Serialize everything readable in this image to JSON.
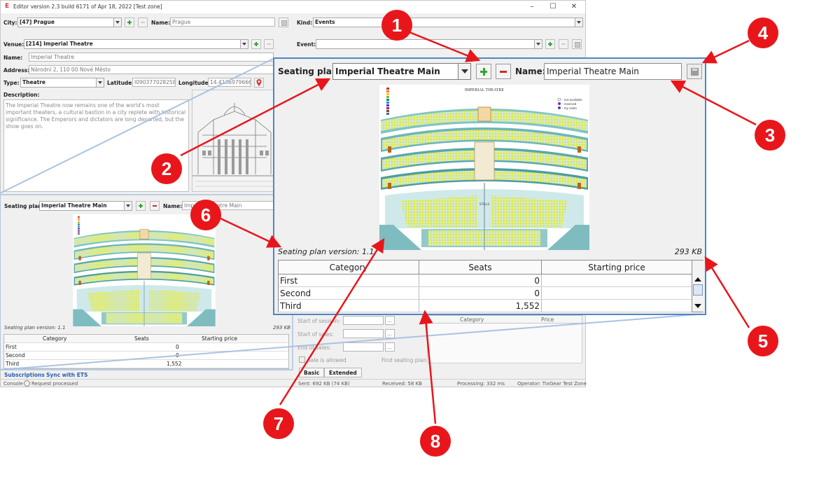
{
  "window": {
    "title": "Editor version 2.3 build 6171 of Apr 18, 2022 [Test zone]",
    "app_icon": "E",
    "controls": [
      "minimize-icon",
      "maximize-icon",
      "close-icon"
    ]
  },
  "city": {
    "label": "City:",
    "value": "[47] Prague",
    "name_label": "Name:",
    "name_value": "Prague"
  },
  "kind": {
    "label": "Kind:",
    "value": "Events"
  },
  "event": {
    "label": "Event:"
  },
  "venue": {
    "label": "Venue:",
    "value": "[214] Imperial Theatre",
    "name_label": "Name:",
    "name_value": "Imperial Theatre",
    "address_label": "Address:",
    "address_value": "Národní 2, 110 00 Nové Město",
    "type_label": "Type:",
    "type_value": "Theatre",
    "latitude_label": "Latitude:",
    "latitude_value": "I090377028258",
    "longitude_label": "Longitude:",
    "longitude_value": "14.4136979666",
    "description_label": "Description:",
    "description": "The Imperial Theatre now remains one of the world's most important theaters, a cultural bastion in a city replete with historical significance. The Emperors and dictators are long departed, but the show goes on."
  },
  "small_seating": {
    "label": "Seating plan:",
    "value": "Imperial Theatre Main",
    "name_label": "Name:",
    "name_value": "Imperial Theatre Main",
    "plan_title": "IMPERIAL THEATRE",
    "version": "Seating plan version: 1.1",
    "size": "293 KB",
    "headers": [
      "Category",
      "Seats",
      "Starting price"
    ],
    "rows": [
      [
        "First",
        "0",
        ""
      ],
      [
        "Second",
        "0",
        ""
      ],
      [
        "Third",
        "1,552",
        ""
      ]
    ]
  },
  "right_panel": {
    "start_session": "Start of session:",
    "start_sales": "Start of sales:",
    "end_sales": "End of sales:",
    "sale_allowed": "Sale is allowed",
    "find_plan": "Find seating plan",
    "table_headers": [
      "Category",
      "Price"
    ]
  },
  "tabs": [
    "Basic",
    "Extended"
  ],
  "links": [
    "Subscriptions",
    "Sync with ETS"
  ],
  "status": {
    "console": "Console",
    "message": "Request processed",
    "sent": "Sent: 692 KB (74 KB)",
    "received": "Received: 58 KB",
    "processing": "Processing: 332 ms",
    "operator": "Operator: TixGear Test Zone"
  },
  "zoom": {
    "label": "Seating plan:",
    "value": "Imperial Theatre Main",
    "name_label": "Name:",
    "name_value": "Imperial Theatre Main",
    "plan_title": "IMPERIAL THEATRE",
    "legend": [
      "- not available",
      "- reserved",
      "- my seats"
    ],
    "stalls_label": "STALLS",
    "version": "Seating plan version: 1.1",
    "size": "293 KB",
    "headers": [
      "Category",
      "Seats",
      "Starting price"
    ],
    "rows": [
      [
        "First",
        "0",
        ""
      ],
      [
        "Second",
        "0",
        ""
      ],
      [
        "Third",
        "1,552",
        ""
      ]
    ]
  },
  "callouts": [
    "1",
    "2",
    "3",
    "4",
    "5",
    "6",
    "7",
    "8"
  ],
  "colors": {
    "accent_blue": "#4f86c6",
    "callout_red": "#e8161b",
    "add_green": "#2fa52f",
    "remove_red": "#cc2b2b",
    "seat_yellow": "#e6ea1e",
    "seat_teal": "#5fb5b5"
  }
}
